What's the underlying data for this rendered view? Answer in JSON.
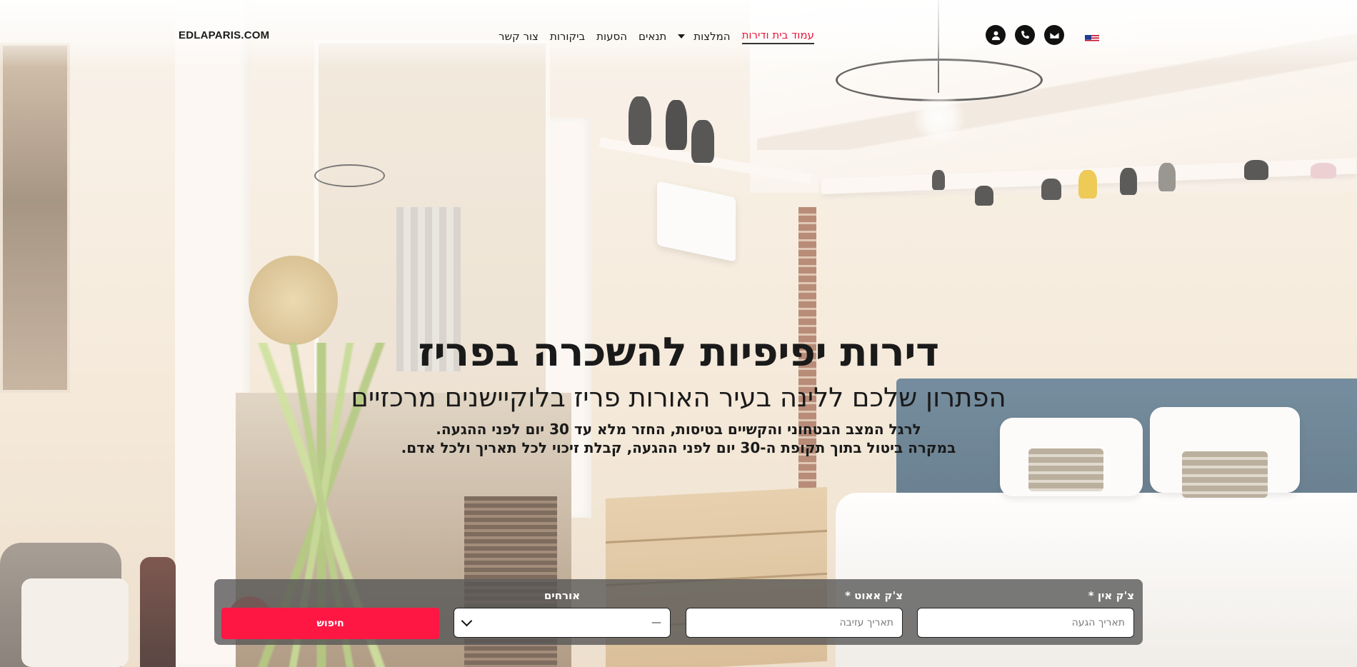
{
  "brand": {
    "name": "EDLAPARIS.COM"
  },
  "nav": {
    "items": [
      {
        "label": "עמוד בית ודירות",
        "active": true
      },
      {
        "label": "המלצות",
        "dropdown": true
      },
      {
        "label": "תנאים"
      },
      {
        "label": "הסעות"
      },
      {
        "label": "ביקורות"
      },
      {
        "label": "צור קשר"
      }
    ]
  },
  "header_icons": [
    "user-icon",
    "phone-icon",
    "envelope-icon",
    "us-flag-icon"
  ],
  "hero": {
    "title": "דירות יפיפיות להשכרה בפריז",
    "subtitle": "הפתרון שלכם ללינה בעיר האורות פריז בלוקיישנים מרכזיים",
    "line1": "לרגל המצב הבטחוני והקשיים בטיסות, החזר מלא עד 30 יום לפני ההגעה.",
    "line2": "במקרה ביטול בתוך תקופת ה-30 יום לפני ההגעה, קבלת זיכוי לכל תאריך ולכל אדם."
  },
  "booking": {
    "checkin_label": "צ'ק אין",
    "checkin_required": "*",
    "checkin_placeholder": "תאריך הגעה",
    "checkout_label": "צ'ק אאוט",
    "checkout_required": "*",
    "checkout_placeholder": "תאריך עזיבה",
    "guests_label": "אורחים",
    "guests_value": "—",
    "search_label": "חיפוש"
  },
  "colors": {
    "accent": "#ff1744",
    "active_nav": "#e8173b",
    "form_bg": "#555555"
  }
}
